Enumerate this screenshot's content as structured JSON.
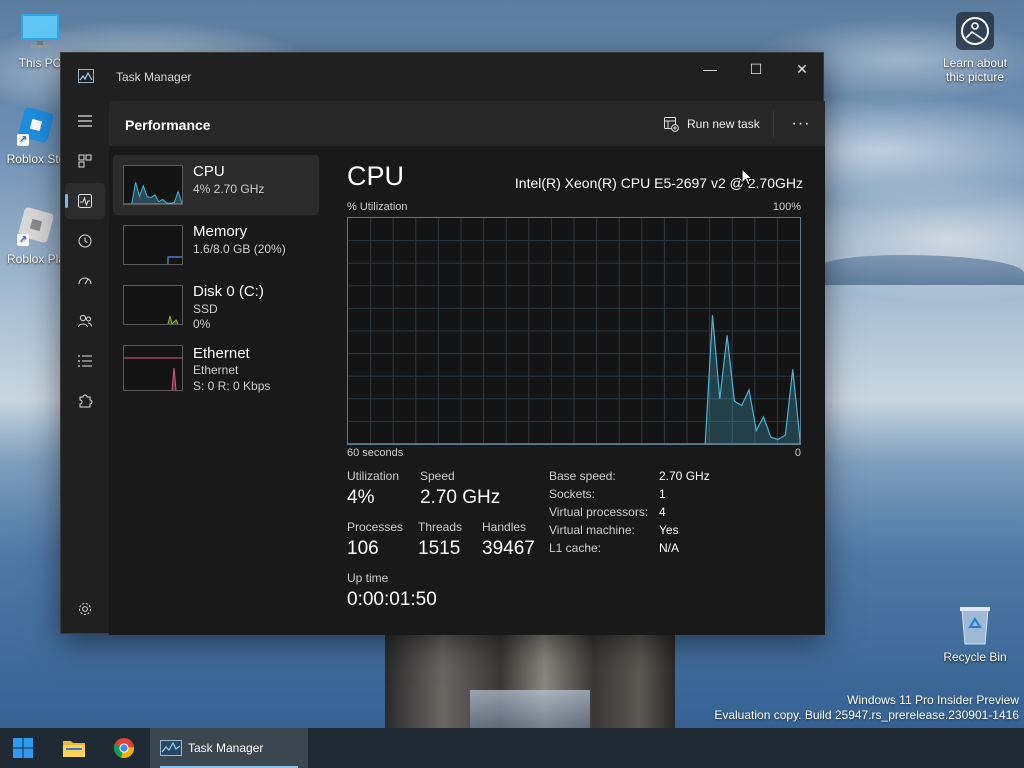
{
  "desktop": {
    "icons": [
      {
        "label": "This PC"
      },
      {
        "label": "Roblox Stu"
      },
      {
        "label": "Roblox Pla"
      }
    ],
    "learn_about": "Learn about this picture",
    "recycle_bin": "Recycle Bin",
    "watermark": {
      "line1": "Windows 11 Pro Insider Preview",
      "line2": "Evaluation copy. Build 25947.rs_prerelease.230901-1416"
    }
  },
  "window": {
    "title": "Task Manager",
    "controls": {
      "minimize": "—",
      "maximize": "☐",
      "close": "✕"
    }
  },
  "header": {
    "title": "Performance",
    "run_new_task": "Run new task",
    "more": "···"
  },
  "resources": [
    {
      "name": "CPU",
      "line1": "4%  2.70 GHz"
    },
    {
      "name": "Memory",
      "line1": "1.6/8.0 GB (20%)"
    },
    {
      "name": "Disk 0 (C:)",
      "line1": "SSD",
      "line2": "0%"
    },
    {
      "name": "Ethernet",
      "line1": "Ethernet",
      "line2": "S: 0  R: 0 Kbps"
    }
  ],
  "cpu": {
    "title": "CPU",
    "model": "Intel(R) Xeon(R) CPU E5-2697 v2 @ 2.70GHz",
    "graph_label": "% Utilization",
    "graph_max": "100%",
    "graph_time": "60 seconds",
    "graph_zero": "0",
    "stats": {
      "utilization_label": "Utilization",
      "utilization": "4%",
      "speed_label": "Speed",
      "speed": "2.70 GHz",
      "processes_label": "Processes",
      "processes": "106",
      "threads_label": "Threads",
      "threads": "1515",
      "handles_label": "Handles",
      "handles": "39467",
      "uptime_label": "Up time",
      "uptime": "0:00:01:50"
    },
    "specs": [
      {
        "key": "Base speed:",
        "value": "2.70 GHz"
      },
      {
        "key": "Sockets:",
        "value": "1"
      },
      {
        "key": "Virtual processors:",
        "value": "4"
      },
      {
        "key": "Virtual machine:",
        "value": "Yes"
      },
      {
        "key": "L1 cache:",
        "value": "N/A"
      }
    ],
    "history_percent": [
      0,
      0,
      0,
      0,
      0,
      0,
      0,
      0,
      0,
      0,
      0,
      0,
      0,
      0,
      0,
      0,
      0,
      0,
      0,
      0,
      0,
      0,
      0,
      0,
      0,
      0,
      0,
      0,
      0,
      0,
      0,
      0,
      0,
      0,
      0,
      0,
      0,
      0,
      0,
      0,
      0,
      0,
      0,
      0,
      0,
      0,
      0,
      0,
      0,
      0,
      57,
      20,
      48,
      19,
      17,
      24,
      6,
      12,
      3,
      2,
      4,
      33,
      2
    ]
  },
  "taskbar": {
    "active_app": "Task Manager"
  },
  "colors": {
    "accent": "#76b9ed",
    "cpu_line": "#4cb3d4",
    "memory_line": "#5a8ef0",
    "disk_line": "#8fbf2a",
    "ethernet_line": "#e0587e"
  }
}
